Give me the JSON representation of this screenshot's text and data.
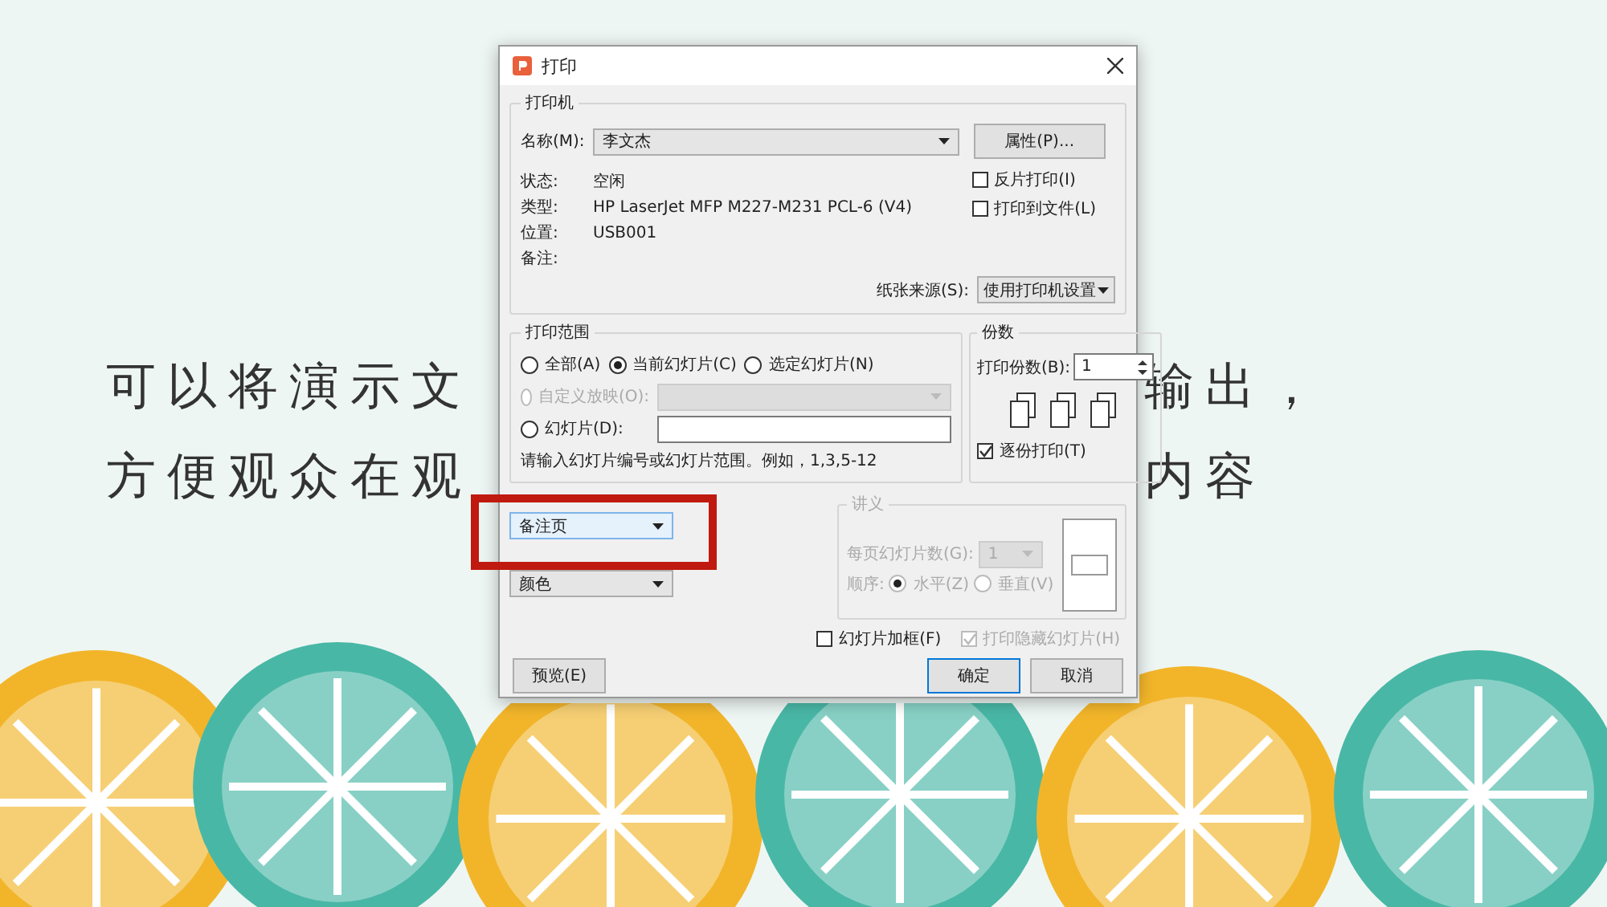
{
  "slide": {
    "text_lines": [
      {
        "left": "可以将演示文",
        "right": "输出，"
      },
      {
        "left": "方便观众在观",
        "right": "内容"
      }
    ]
  },
  "dialog": {
    "title": "打印",
    "printer": {
      "group_title": "打印机",
      "name_label": "名称(M):",
      "name_value": "李文杰",
      "properties_button": "属性(P)...",
      "info": [
        {
          "label": "状态:",
          "value": "空闲"
        },
        {
          "label": "类型:",
          "value": "HP LaserJet MFP M227-M231 PCL-6 (V4)"
        },
        {
          "label": "位置:",
          "value": "USB001"
        },
        {
          "label": "备注:"
        }
      ],
      "options": [
        {
          "label": "反片打印(I)",
          "checked": false
        },
        {
          "label": "打印到文件(L)",
          "checked": false
        }
      ],
      "paper_source_label": "纸张来源(S):",
      "paper_source_value": "使用打印机设置"
    },
    "range": {
      "group_title": "打印范围",
      "radios": [
        {
          "label": "全部(A)",
          "selected": false,
          "disabled": false,
          "kind": "plain"
        },
        {
          "label": "当前幻灯片(C)",
          "selected": true,
          "disabled": false,
          "kind": "plain"
        },
        {
          "label": "选定幻灯片(N)",
          "selected": false,
          "disabled": false,
          "kind": "plain"
        },
        {
          "label": "自定义放映(O):",
          "selected": false,
          "disabled": true,
          "kind": "dropdown"
        },
        {
          "label": "幻灯片(D):",
          "selected": false,
          "disabled": false,
          "kind": "input"
        }
      ],
      "hint": "请输入幻灯片编号或幻灯片范围。例如，1,3,5-12"
    },
    "copies": {
      "group_title": "份数",
      "count_label": "打印份数(B):",
      "count_value": "1",
      "collate": {
        "label": "逐份打印(T)",
        "checked": true
      }
    },
    "print_what": {
      "value": "备注页",
      "highlighted": true
    },
    "color": {
      "value": "颜色"
    },
    "handouts": {
      "group_title": "讲义",
      "disabled": true,
      "per_page_label": "每页幻灯片数(G):",
      "per_page_value": "1",
      "order_label": "顺序:",
      "orders": [
        {
          "label": "水平(Z)",
          "selected": true
        },
        {
          "label": "垂直(V)",
          "selected": false
        }
      ]
    },
    "checks": [
      {
        "label": "幻灯片加框(F)",
        "checked": false,
        "disabled": false
      },
      {
        "label": "打印隐藏幻灯片(H)",
        "checked": true,
        "disabled": true
      }
    ],
    "buttons": [
      {
        "label": "预览(E)",
        "kind": "preview"
      },
      {
        "label": "确定",
        "kind": "primary"
      },
      {
        "label": "取消",
        "kind": "default"
      }
    ]
  }
}
